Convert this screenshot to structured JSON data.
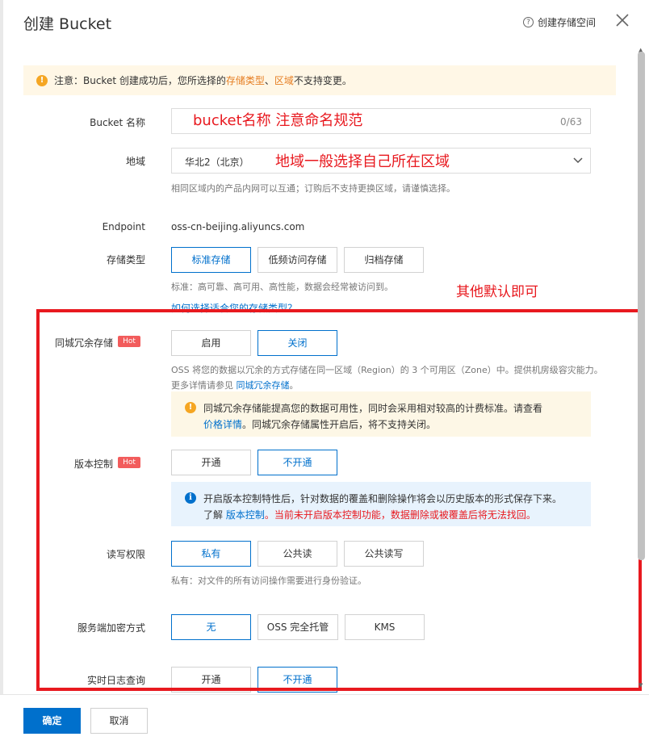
{
  "header": {
    "title": "创建 Bucket",
    "help_link": "创建存储空间"
  },
  "notice": {
    "prefix": "注意：Bucket 创建成功后，您所选择的 ",
    "highlight1": "存储类型",
    "separator": "、",
    "highlight2": "区域",
    "suffix": " 不支持变更。"
  },
  "fields": {
    "bucket_name": {
      "label": "Bucket 名称",
      "value": "",
      "counter": "0/63"
    },
    "region": {
      "label": "地域",
      "value": "华北2（北京）",
      "help": "相同区域内的产品内网可以互通；订购后不支持更换区域，请谨慎选择。"
    },
    "endpoint": {
      "label": "Endpoint",
      "value": "oss-cn-beijing.aliyuncs.com"
    },
    "storage_class": {
      "label": "存储类型",
      "options": [
        "标准存储",
        "低频访问存储",
        "归档存储"
      ],
      "selected": "标准存储",
      "help": "标准：高可靠、高可用、高性能，数据会经常被访问到。",
      "link": "如何选择适合您的存储类型？"
    },
    "redundancy": {
      "label": "同城冗余存储",
      "badge": "Hot",
      "options": [
        "启用",
        "关闭"
      ],
      "selected": "关闭",
      "help_prefix": "OSS 将您的数据以冗余的方式存储在同一区域（Region）的 3 个可用区（Zone）中。提供机房级容灾能力。更多详情请参见 ",
      "help_link": "同城冗余存储",
      "help_suffix": "。",
      "warning_line1": "同城冗余存储能提高您的数据可用性，同时会采用相对较高的计费标准。请查看",
      "warning_link": "价格详情",
      "warning_line2": "。同城冗余存储属性开启后，将不支持关闭。"
    },
    "versioning": {
      "label": "版本控制",
      "badge": "Hot",
      "options": [
        "开通",
        "不开通"
      ],
      "selected": "不开通",
      "info_line1": "开启版本控制特性后，针对数据的覆盖和删除操作将会以历史版本的形式保存下来。",
      "info_prefix": "了解 ",
      "info_link": "版本控制",
      "info_warn": "。当前未开启版本控制功能，数据删除或被覆盖后将无法找回。"
    },
    "acl": {
      "label": "读写权限",
      "options": [
        "私有",
        "公共读",
        "公共读写"
      ],
      "selected": "私有",
      "help": "私有：对文件的所有访问操作需要进行身份验证。"
    },
    "encryption": {
      "label": "服务端加密方式",
      "options": [
        "无",
        "OSS 完全托管",
        "KMS"
      ],
      "selected": "无"
    },
    "logging": {
      "label": "实时日志查询",
      "options": [
        "开通",
        "不开通"
      ],
      "selected": "不开通"
    }
  },
  "annotations": {
    "bucket_name": "bucket名称 注意命名规范",
    "region": "地域一般选择自己所在区域",
    "defaults": "其他默认即可"
  },
  "footer": {
    "confirm": "确定",
    "cancel": "取消"
  },
  "colors": {
    "primary": "#0070cc",
    "warning_bg": "#fff7e6",
    "info_bg": "#e8f3fd",
    "hot_badge": "#f25c5c",
    "annotation_red": "#e8191f",
    "highlight_orange": "#e67e22"
  },
  "icons": [
    "help-icon",
    "close-icon",
    "warning-icon",
    "chevron-down-icon",
    "info-icon"
  ]
}
